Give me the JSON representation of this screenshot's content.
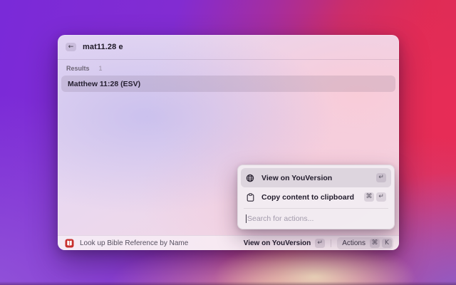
{
  "window": {
    "search": {
      "value": "mat11.28 e",
      "back_glyph": "←"
    },
    "results": {
      "label": "Results",
      "count": "1"
    },
    "list": [
      {
        "title": "Matthew 11:28 (ESV)",
        "selected": true
      }
    ],
    "status_bar": {
      "app_icon": "bible-red-book-icon",
      "command_name": "Look up Bible Reference by Name",
      "primary_action": {
        "label": "View on YouVersion",
        "keys": [
          "↵"
        ]
      },
      "actions_button": {
        "label": "Actions",
        "keys": [
          "⌘",
          "K"
        ]
      }
    }
  },
  "action_panel": {
    "items": [
      {
        "icon": "globe-icon",
        "label": "View on YouVersion",
        "keys": [
          "↵"
        ],
        "selected": true
      },
      {
        "icon": "clipboard-icon",
        "label": "Copy content to clipboard",
        "keys": [
          "⌘",
          "↵"
        ],
        "selected": false
      }
    ],
    "search": {
      "placeholder": "Search for actions..."
    }
  },
  "colors": {
    "desktop_purple": "#7a2ad8",
    "desktop_crimson": "#dd2b55",
    "bible_icon_red": "#c7302e",
    "selection_overlay": "rgba(103,87,111,0.16)"
  }
}
